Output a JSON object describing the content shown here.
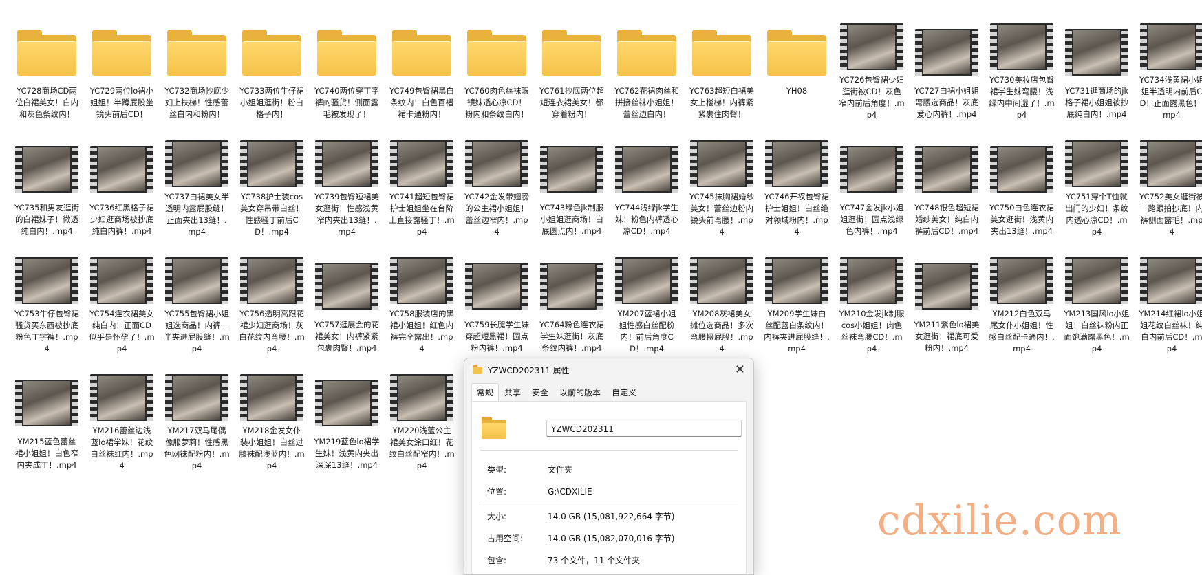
{
  "folders": [
    {
      "label": "YC728商场CD两位白裙美女！白内和灰色条纹内！"
    },
    {
      "label": "YC729两位lo裙小姐姐！半蹲屁股坐镜头前后CD！"
    },
    {
      "label": "YC732商场抄底少妇上扶梯！性感蕾丝白内和粉内！"
    },
    {
      "label": "YC733两位牛仔裙小姐姐逛街！粉白格子内！"
    },
    {
      "label": "YC740两位穿丁字裤的骚货！侧面露毛被发现了！"
    },
    {
      "label": "YC749包臀裙黑白条纹内！白色百褶裙卡通粉内！"
    },
    {
      "label": "YC760肉色丝袜眼镜妹透心凉CD！粉内和条纹白内！"
    },
    {
      "label": "YC761抄底两位超短连衣裙美女！都穿着粉内！"
    },
    {
      "label": "YC762花裙肉丝和拼接丝袜小姐姐！蕾丝边白内！"
    },
    {
      "label": "YC763超短白裙美女上楼梯！内裤紧紧裹住肉臀！"
    },
    {
      "label": "YH08"
    }
  ],
  "videos_row1": [
    {
      "label": "YC726包臀裙少妇逛街被CD！灰色窄内前后角度！.mp4"
    },
    {
      "label": "YC727白裙小姐姐弯腰选商品！灰底爱心内裤！.mp4"
    },
    {
      "label": "YC730美妆店包臀裙学生妹弯腰！浅绿内中间湿了！.mp4"
    },
    {
      "label": "YC731逛商场的jk格子裙小姐姐被抄底纯白内！.mp4"
    },
    {
      "label": "YC734浅黄裙小姐姐半透明内前后CD！正面露黑色！.mp4"
    }
  ],
  "videos_row2": [
    {
      "label": "YC735和男友逛街的白裙妹子！微透纯白内！.mp4"
    },
    {
      "label": "YC736红黑格子裙少妇逛商场被抄底纯白内裤！.mp4"
    },
    {
      "label": "YC737白裙美女半透明内露屁股缝！正面夹出13缝！.mp4"
    },
    {
      "label": "YC738护士装cos美女穿吊带白丝！性感骚丁前后CD！.mp4"
    },
    {
      "label": "YC739包臀短裙美女逛街！性感浅黄窄内夹出13缝！.mp4"
    },
    {
      "label": "YC741超短包臀裙护士姐姐坐在台阶上直接露骚丁！.mp4"
    },
    {
      "label": "YC742金发带翅膀的公主裙小姐姐！蕾丝边窄内！.mp4"
    },
    {
      "label": "YC743绿色jk制服小姐姐逛商场！白底圆点内！.mp4"
    },
    {
      "label": "YC744浅绿jk学生妹！粉色内裤透心凉CD！.mp4"
    },
    {
      "label": "YC745抹胸裙婚纱美女！蕾丝边粉内镜头前弯腰！.mp4"
    },
    {
      "label": "YC746开衩包臀裙护士姐姐！白丝绝对领域粉内！.mp4"
    },
    {
      "label": "YC747金发jk小姐姐逛街！圆点浅绿色内裤！.mp4"
    },
    {
      "label": "YC748银色超短裙婚纱美女！纯白内裤前后CD！.mp4"
    },
    {
      "label": "YC750白色连衣裙美女逛街！浅黄内夹出13缝！.mp4"
    },
    {
      "label": "YC751穿个T恤就出门的少妇！条纹内透心凉CD！.mp4"
    },
    {
      "label": "YC752美女逛街被一路跟拍抄底！内裤侧面露毛！.mp4"
    }
  ],
  "videos_row3": [
    {
      "label": "YC753牛仔包臀裙骚货买东西被抄底粉色丁字裤！.mp4"
    },
    {
      "label": "YC754连衣裙美女纯白内！正面CD似乎是怀孕了！.mp4"
    },
    {
      "label": "YC755包臀裙小姐姐选商品！内裤一半夹进屁股缝！.mp4"
    },
    {
      "label": "YC756透明高跟花裙少妇逛商场！灰白花纹内弯腰！.mp4"
    },
    {
      "label": "YC757逛展会的花裙美女！内裤紧紧包裹肉臀！.mp4"
    },
    {
      "label": "YC758服装店的黑裙小姐姐！红色内裤完全露出！.mp4"
    },
    {
      "label": "YC759长腿学生妹穿超短黑裙！圆点粉内裤！.mp4"
    },
    {
      "label": "YC764粉色连衣裙学生妹逛街！灰底条纹内裤！.mp4"
    },
    {
      "label": "YM207蓝裙小姐姐性感白丝配粉内！前后角度CD！.mp4"
    },
    {
      "label": "YM208灰裙美女摊位选商品！多次弯腰撅屁股！.mp4"
    },
    {
      "label": "YM209学生妹白丝配蓝白条纹内！内裤夹进屁股缝！.mp4"
    },
    {
      "label": "YM210金发jk制服cos小姐姐！肉色丝袜弯腰CD！.mp4"
    },
    {
      "label": "YM211紫色lo裙美女逛街！裙底可爱粉内！.mp4"
    },
    {
      "label": "YM212白色双马尾女仆小姐姐！性感白丝配卡通内！.mp4"
    },
    {
      "label": "YM213国风lo小姐姐！白丝袜粉内正面饱满露黑色！.mp4"
    },
    {
      "label": "YM214红裙lo小姐姐花纹白丝袜！纯白内前后CD！.mp4"
    }
  ],
  "videos_row4": [
    {
      "label": "YM215蓝色蕾丝裙小姐姐！白色窄内夹成丁！.mp4"
    },
    {
      "label": "YM216蕾丝边浅蓝lo裙学妹！花纹白丝袜红内！.mp4"
    },
    {
      "label": "YM217双马尾偶像服萝莉！性感黑色网袜配粉内！.mp4"
    },
    {
      "label": "YM218金发女仆装小姐姐！白丝过膝袜配浅蓝内！.mp4"
    },
    {
      "label": "YM219蓝色lo裙学生妹！浅黄内夹出深深13缝！.mp4"
    },
    {
      "label": "YM220浅蓝公主裙美女涂口红！花纹白丝配窄内！.mp4"
    }
  ],
  "dialog": {
    "title": "YZWCD202311 属性",
    "close_glyph": "✕",
    "tabs": [
      "常规",
      "共享",
      "安全",
      "以前的版本",
      "自定义"
    ],
    "name_value": "YZWCD202311",
    "rows": [
      {
        "key": "类型:",
        "value": "文件夹"
      },
      {
        "key": "位置:",
        "value": "G:\\CDXILIE"
      },
      {
        "key": "大小:",
        "value": "14.0 GB (15,081,922,664 字节)"
      },
      {
        "key": "占用空间:",
        "value": "14.0 GB (15,082,070,016 字节)"
      },
      {
        "key": "包含:",
        "value": "73 个文件，11 个文件夹"
      }
    ]
  },
  "watermark": "cdxilie.com",
  "icons": {
    "folder": "folder-icon",
    "video": "video-file-icon"
  }
}
